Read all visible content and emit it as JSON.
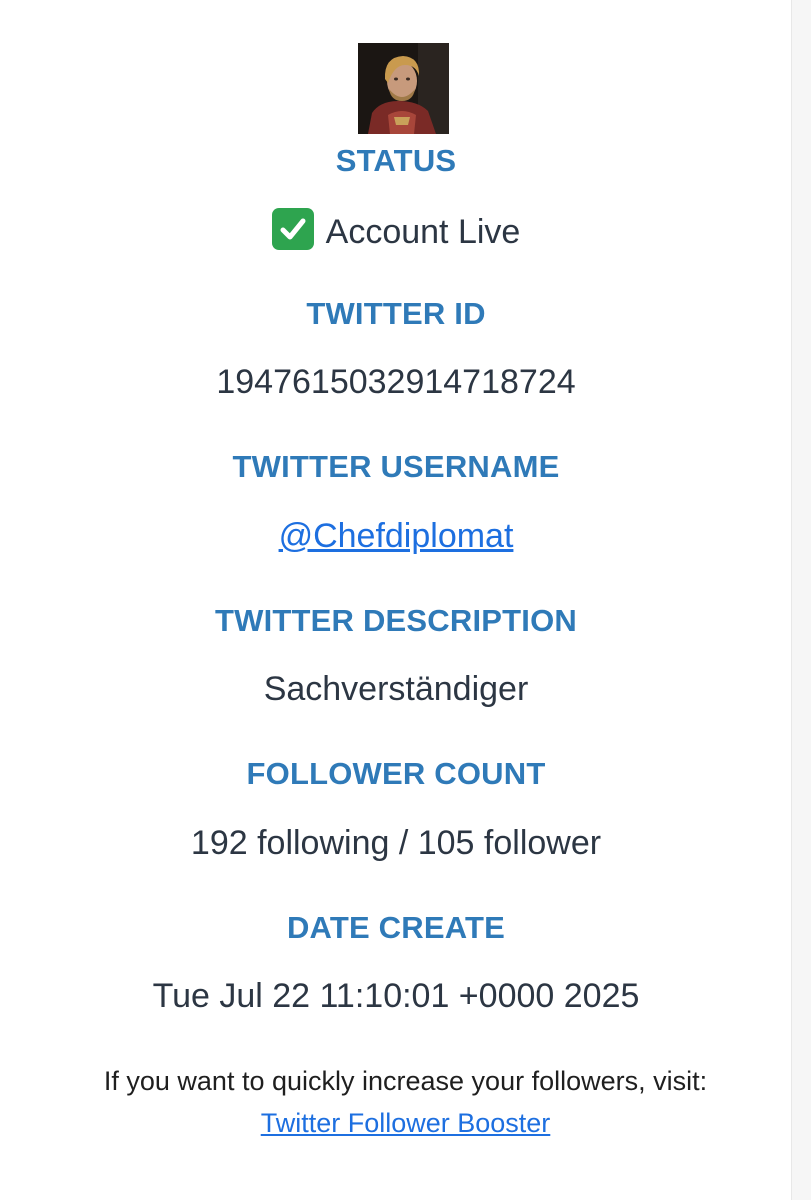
{
  "avatar": {
    "icon": "profile-photo-icon"
  },
  "status": {
    "label": "STATUS",
    "icon": "check-mark-button-icon",
    "value": "Account Live"
  },
  "twitter_id": {
    "label": "TWITTER ID",
    "value": "1947615032914718724"
  },
  "twitter_username": {
    "label": "TWITTER USERNAME",
    "value": "@Chefdiplomat"
  },
  "twitter_description": {
    "label": "TWITTER DESCRIPTION",
    "value": "Sachverständiger"
  },
  "follower_count": {
    "label": "FOLLOWER COUNT",
    "value": "192 following / 105 follower"
  },
  "date_create": {
    "label": "DATE CREATE",
    "value": "Tue Jul 22 11:10:01 +0000 2025"
  },
  "promo": {
    "text": "If you want to quickly increase your followers, visit:",
    "link_label": "Twitter Follower Booster"
  },
  "colors": {
    "label": "#2f7ab8",
    "value_text": "#2c3643",
    "link": "#1d6fe0",
    "check": "#2ea44f"
  }
}
